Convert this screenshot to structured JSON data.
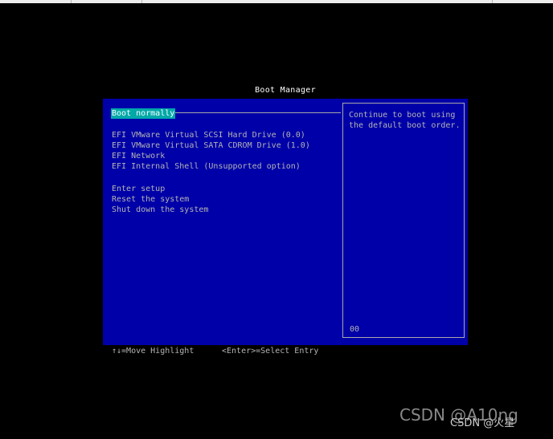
{
  "screen": {
    "title": "Boot Manager",
    "colors": {
      "background": "#000000",
      "panel": "#0000a8",
      "highlight": "#00a8a8",
      "text": "#b4b4b4",
      "title_text": "#ffffff"
    }
  },
  "menu": {
    "selected_item": "Boot normally",
    "boot_options": [
      "EFI VMware Virtual SCSI Hard Drive (0.0)",
      "EFI VMware Virtual SATA CDROM Drive (1.0)",
      "EFI Network",
      "EFI Internal Shell (Unsupported option)"
    ],
    "system_options": [
      "Enter setup",
      "Reset the system",
      "Shut down the system"
    ]
  },
  "help": {
    "text": "Continue to boot using\nthe default boot order.",
    "code": "00"
  },
  "footer": {
    "move_hint": "↑↓=Move Highlight",
    "select_hint": "<Enter>=Select Entry"
  },
  "watermark": {
    "large": "CSDN @A10ng",
    "small": "CSDN @火星"
  }
}
